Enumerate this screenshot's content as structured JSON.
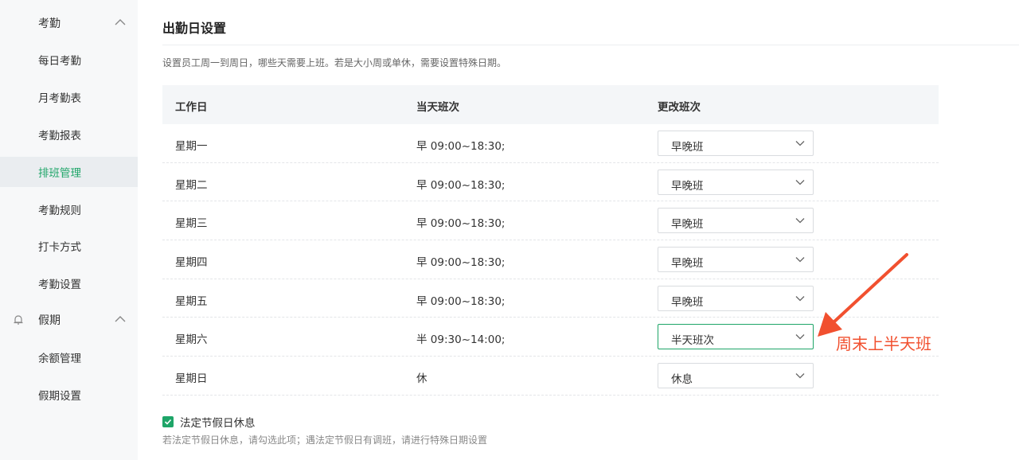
{
  "sidebar": {
    "groups": [
      {
        "label": "考勤",
        "items": [
          "每日考勤",
          "月考勤表",
          "考勤报表",
          "排班管理",
          "考勤规则",
          "打卡方式",
          "考勤设置"
        ]
      },
      {
        "label": "假期",
        "items": [
          "余额管理",
          "假期设置"
        ]
      }
    ],
    "active_item": "排班管理",
    "icons": {
      "group2": "bell-icon",
      "expand": "chevron-up-icon"
    }
  },
  "main": {
    "title": "出勤日设置",
    "description": "设置员工周一到周日，哪些天需要上班。若是大小周或单休，需要设置特殊日期。",
    "table": {
      "headers": [
        "工作日",
        "当天班次",
        "更改班次"
      ],
      "rows": [
        {
          "day": "星期一",
          "shift": "早 09:00~18:30;",
          "select": "早晚班"
        },
        {
          "day": "星期二",
          "shift": "早 09:00~18:30;",
          "select": "早晚班"
        },
        {
          "day": "星期三",
          "shift": "早 09:00~18:30;",
          "select": "早晚班"
        },
        {
          "day": "星期四",
          "shift": "早 09:00~18:30;",
          "select": "早晚班"
        },
        {
          "day": "星期五",
          "shift": "早 09:00~18:30;",
          "select": "早晚班"
        },
        {
          "day": "星期六",
          "shift": "半 09:30~14:00;",
          "select": "半天班次"
        },
        {
          "day": "星期日",
          "shift": "休",
          "select": "休息"
        }
      ]
    },
    "holiday_checkbox": {
      "checked": true,
      "label": "法定节假日休息",
      "hint": "若法定节假日休息，请勾选此项；遇法定节假日有调班，请进行特殊日期设置"
    },
    "annotation": "周末上半天班",
    "colors": {
      "accent": "#1ea568",
      "annotation": "#f1502f",
      "sidebar_bg": "#f7f8f9",
      "table_header_bg": "#f4f6f8"
    }
  }
}
